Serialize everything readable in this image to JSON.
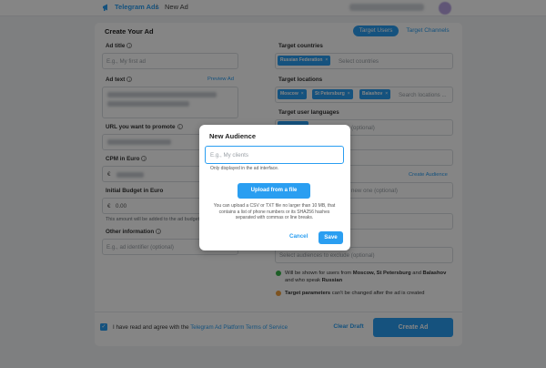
{
  "header": {
    "brand": "Telegram Ads",
    "separator": "/",
    "breadcrumb": "New Ad"
  },
  "form": {
    "title": "Create Your Ad",
    "tabs": [
      "Target Users",
      "Target Channels"
    ],
    "ad_title": {
      "label": "Ad title",
      "placeholder": "E.g., My first ad"
    },
    "ad_text": {
      "label": "Ad text",
      "preview_link": "Preview Ad"
    },
    "url": {
      "label": "URL you want to promote"
    },
    "cpm": {
      "label": "CPM in Euro",
      "currency": "€"
    },
    "budget": {
      "label": "Initial Budget in Euro",
      "currency": "€",
      "value": "0.00",
      "hint": "This amount will be added to the ad budget"
    },
    "other_info": {
      "label": "Other information",
      "placeholder": "E.g., ad identifier (optional)"
    },
    "countries": {
      "label": "Target countries",
      "tags": [
        "Russian Federation"
      ],
      "placeholder": "Select countries"
    },
    "locations": {
      "label": "Target locations",
      "tags": [
        "Moscow",
        "St Petersburg",
        "Balashov"
      ],
      "placeholder": "Search locations ..."
    },
    "languages": {
      "label": "Target user languages",
      "suffix": "(optional)"
    },
    "create_audience_link": "Create Audience",
    "audience_tail": "new one (optional)",
    "exclude_placeholder": "Select audiences to exclude (optional)",
    "status_ok_prefix": "Will be shown for users from ",
    "status_ok_places": "Moscow, St Petersburg",
    "status_ok_and": " and ",
    "status_ok_last": "Balashov",
    "status_ok_line2_prefix": "and who speak ",
    "status_ok_lang": "Russian",
    "status_warn_bold": "Target parameters",
    "status_warn_rest": " can't be changed after the ad is created"
  },
  "footer": {
    "agree_text": "I have read and agree with the ",
    "agree_link": "Telegram Ad Platform Terms of Service",
    "clear_label": "Clear Draft",
    "create_label": "Create Ad"
  },
  "modal": {
    "title": "New Audience",
    "input_placeholder": "E.g., My clients",
    "input_hint": "Only displayed in the ad interface.",
    "upload_label": "Upload from a file",
    "description": "You can upload a CSV or TXT file no larger than 10 MB, that contains a list of phone numbers or its SHA256 hashes separated with commas or line breaks.",
    "cancel_label": "Cancel",
    "save_label": "Save"
  },
  "colors": {
    "accent": "#2a9ef1",
    "success": "#39b54a",
    "warning": "#f0a040"
  },
  "icons": {
    "logo": "megaphone-icon",
    "info": "info-circle-icon",
    "check": "check-icon",
    "close": "close-icon"
  }
}
